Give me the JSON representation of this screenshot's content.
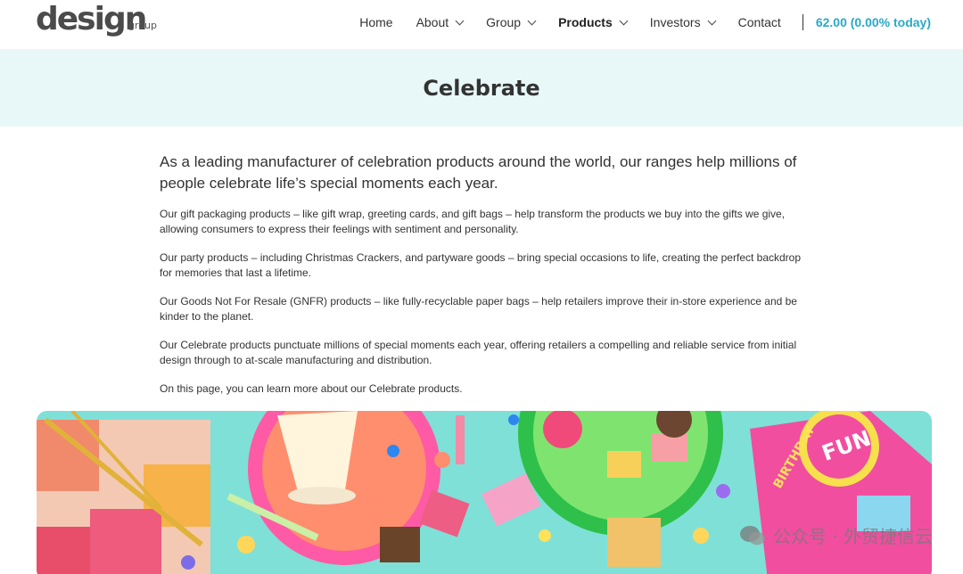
{
  "header": {
    "logo_main": "design",
    "logo_sub": "group",
    "nav": [
      {
        "label": "Home",
        "dropdown": false
      },
      {
        "label": "About",
        "dropdown": true
      },
      {
        "label": "Group",
        "dropdown": true
      },
      {
        "label": "Products",
        "dropdown": true,
        "active": true
      },
      {
        "label": "Investors",
        "dropdown": true
      },
      {
        "label": "Contact",
        "dropdown": false
      }
    ],
    "share_price": "62.00 (0.00% today)"
  },
  "banner": {
    "title": "Celebrate"
  },
  "content": {
    "lead": "As a leading manufacturer of celebration products around the world, our ranges help millions of people celebrate life’s special moments each year.",
    "paragraphs": [
      "Our gift packaging products – like gift wrap, greeting cards, and gift bags – help transform the products we buy into the gifts we give, allowing consumers to express their feelings with sentiment and personality.",
      "Our party products – including Christmas Crackers, and partyware goods – bring special occasions to life, creating the perfect backdrop for memories that last a lifetime.",
      "Our Goods Not For Resale (GNFR) products – like fully-recyclable paper bags – help retailers improve their in-store experience and be kinder to the planet.",
      "Our Celebrate products punctuate millions of special moments each year, offering retailers a compelling and reliable service from initial design through to at-scale manufacturing and distribution.",
      "On this page, you can learn more about our Celebrate products."
    ]
  },
  "hero": {
    "sign_text": "FUN",
    "sign_sub": "BIRTHDAY"
  },
  "watermark": {
    "text": "公众号 · 外贸捷信云"
  },
  "colors": {
    "accent": "#2aa9c9",
    "banner_bg": "#e8f7f7",
    "hero_bg": "#7fe0d8"
  }
}
